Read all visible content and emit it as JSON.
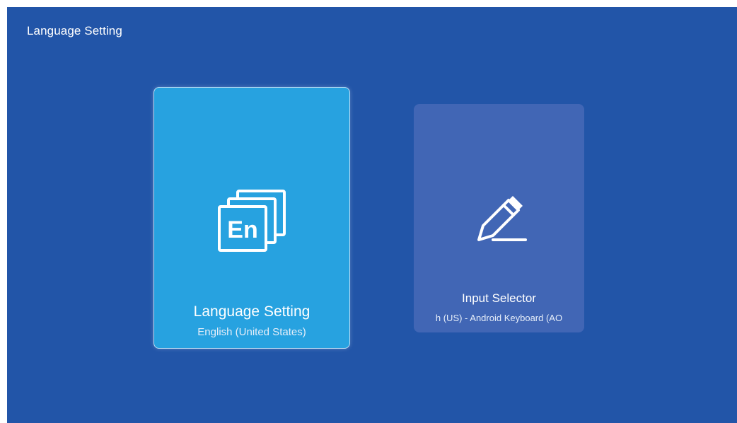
{
  "screen": {
    "title": "Language Setting",
    "background_color": "#2255a8"
  },
  "cards": {
    "language": {
      "icon": "en-language-icon",
      "icon_text": "En",
      "title": "Language Setting",
      "subtitle": "English (United States)",
      "focused": true,
      "color": "#27a2e0"
    },
    "input": {
      "icon": "pencil-icon",
      "title": "Input Selector",
      "subtitle": "h (US) - Android Keyboard (AO",
      "focused": false,
      "color": "#4166b5"
    }
  }
}
